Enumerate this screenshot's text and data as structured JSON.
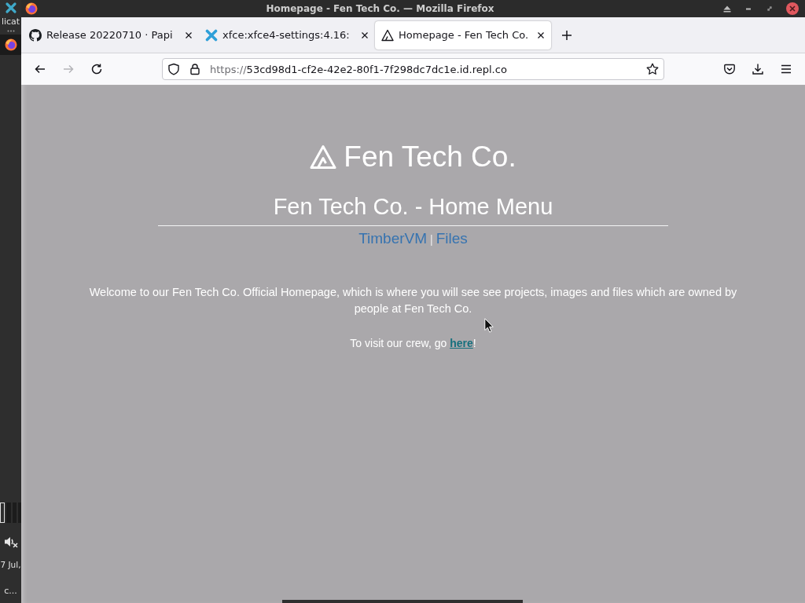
{
  "desktop_panel": {
    "menu_label": "licat",
    "task_button": {
      "selected": true
    },
    "volume": {
      "muted": true
    },
    "clock": "7 Jul,",
    "user": "c..."
  },
  "window": {
    "title": "Homepage - Fen Tech Co. — Mozilla Firefox"
  },
  "tabs": [
    {
      "kind": "github",
      "title": "Release 20220710 · Papi",
      "selected": false
    },
    {
      "kind": "xfce",
      "title": "xfce:xfce4-settings:4.16:",
      "selected": false
    },
    {
      "kind": "site",
      "title": "Homepage - Fen Tech Co.",
      "selected": true
    }
  ],
  "nav_buttons": [
    {
      "kind": "back",
      "disabled": false
    },
    {
      "kind": "forward",
      "disabled": true
    },
    {
      "kind": "reload",
      "disabled": false
    }
  ],
  "address_bar": {
    "scheme": "https://",
    "host": "53cd98d1-cf2e-42e2-80f1-7f298dc7dc1e.id.repl.co"
  },
  "page": {
    "logo_text": "Fen Tech Co.",
    "heading": "Fen Tech Co. - Home Menu",
    "nav_links": [
      {
        "label": "TimberVM"
      },
      {
        "label": "Files"
      }
    ],
    "separator": "|",
    "intro": "Welcome to our Fen Tech Co. Official Homepage, which is where you will see see projects, images and files which are owned by people at Fen Tech Co.",
    "crew": {
      "before": "To visit our crew, go ",
      "link": "here",
      "after": "!"
    }
  }
}
